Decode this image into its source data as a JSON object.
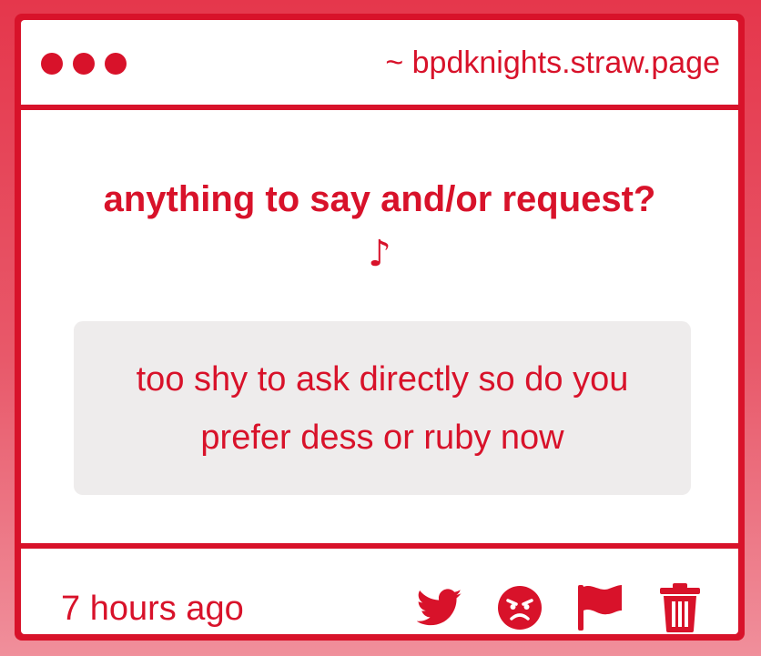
{
  "window": {
    "title": "~ bpdknights.straw.page"
  },
  "prompt": {
    "question": "anything to say and/or request?",
    "note_glyph": "♪"
  },
  "message": {
    "text": "too shy to ask directly so do you prefer dess or ruby now"
  },
  "footer": {
    "timestamp": "7 hours ago",
    "actions": [
      {
        "name": "twitter-share",
        "icon": "twitter-bird-icon"
      },
      {
        "name": "angry-react",
        "icon": "angry-face-icon"
      },
      {
        "name": "report",
        "icon": "flag-icon"
      },
      {
        "name": "delete",
        "icon": "trash-icon"
      }
    ]
  },
  "colors": {
    "accent": "#d8122a",
    "message_bg": "#eeecec",
    "panel_bg": "#ffffff"
  }
}
